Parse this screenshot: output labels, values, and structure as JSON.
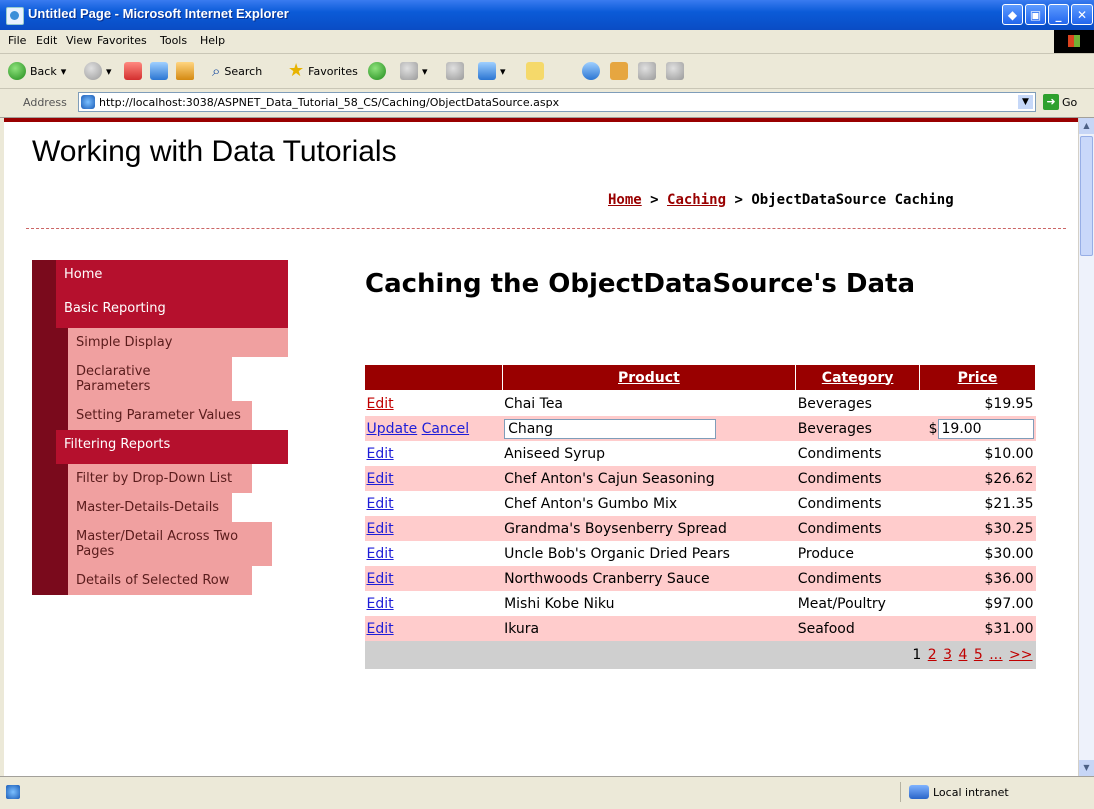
{
  "window": {
    "title": "Untitled Page - Microsoft Internet Explorer"
  },
  "menu": [
    "File",
    "Edit",
    "View",
    "Favorites",
    "Tools",
    "Help"
  ],
  "toolbar": {
    "back": "Back",
    "search": "Search",
    "favorites": "Favorites"
  },
  "address": {
    "label": "Address",
    "url": "http://localhost:3038/ASPNET_Data_Tutorial_58_CS/Caching/ObjectDataSource.aspx",
    "go": "Go"
  },
  "site": {
    "title": "Working with Data Tutorials"
  },
  "breadcrumb": {
    "home": "Home",
    "sep1": " > ",
    "caching": "Caching",
    "sep2": " > ",
    "current": "ObjectDataSource Caching"
  },
  "sidebar": [
    {
      "label": "Home",
      "level": 1
    },
    {
      "label": "Basic Reporting",
      "level": 1
    },
    {
      "label": "Simple Display",
      "level": 2
    },
    {
      "label": "Declarative Parameters",
      "level": 2
    },
    {
      "label": "Setting Parameter Values",
      "level": 2
    },
    {
      "label": "Filtering Reports",
      "level": 1
    },
    {
      "label": "Filter by Drop-Down List",
      "level": 2
    },
    {
      "label": "Master-Details-Details",
      "level": 2
    },
    {
      "label": "Master/Detail Across Two Pages",
      "level": 2
    },
    {
      "label": "Details of Selected Row",
      "level": 2
    }
  ],
  "heading": "Caching the ObjectDataSource's Data",
  "grid": {
    "headers": {
      "product": "Product",
      "category": "Category",
      "price": "Price"
    },
    "edit_label": "Edit",
    "update_label": "Update",
    "cancel_label": "Cancel",
    "edit_row": {
      "product": "Chang",
      "category": "Beverages",
      "currency": "$",
      "price": "19.00"
    },
    "rows": [
      {
        "product": "Chai Tea",
        "category": "Beverages",
        "price": "$19.95"
      },
      {
        "product": "Aniseed Syrup",
        "category": "Condiments",
        "price": "$10.00"
      },
      {
        "product": "Chef Anton's Cajun Seasoning",
        "category": "Condiments",
        "price": "$26.62"
      },
      {
        "product": "Chef Anton's Gumbo Mix",
        "category": "Condiments",
        "price": "$21.35"
      },
      {
        "product": "Grandma's Boysenberry Spread",
        "category": "Condiments",
        "price": "$30.25"
      },
      {
        "product": "Uncle Bob's Organic Dried Pears",
        "category": "Produce",
        "price": "$30.00"
      },
      {
        "product": "Northwoods Cranberry Sauce",
        "category": "Condiments",
        "price": "$36.00"
      },
      {
        "product": "Mishi Kobe Niku",
        "category": "Meat/Poultry",
        "price": "$97.00"
      },
      {
        "product": "Ikura",
        "category": "Seafood",
        "price": "$31.00"
      }
    ],
    "pager": [
      "1",
      "2",
      "3",
      "4",
      "5",
      "...",
      ">>"
    ]
  },
  "status": {
    "zone": "Local intranet"
  }
}
